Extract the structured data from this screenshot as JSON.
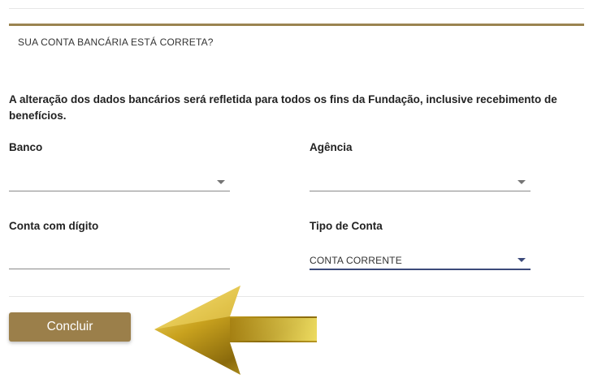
{
  "section": {
    "title": "SUA CONTA BANCÁRIA ESTÁ CORRETA?"
  },
  "notice": "A alteração dos dados bancários será refletida para todos os fins da Fundação, inclusive recebimento de benefícios.",
  "fields": {
    "banco": {
      "label": "Banco",
      "value": ""
    },
    "agencia": {
      "label": "Agência",
      "value": ""
    },
    "conta": {
      "label": "Conta com dígito",
      "value": ""
    },
    "tipo": {
      "label": "Tipo de Conta",
      "value": "CONTA CORRENTE"
    }
  },
  "actions": {
    "submit_label": "Concluir"
  },
  "colors": {
    "accent": "#9b8450",
    "button": "#9b7f4a",
    "active_underline": "#3c4a7a",
    "arrow_gold": "#d4b22a"
  },
  "icons": {
    "dropdown": "chevron-down-icon",
    "pointer": "arrow-left-icon"
  }
}
